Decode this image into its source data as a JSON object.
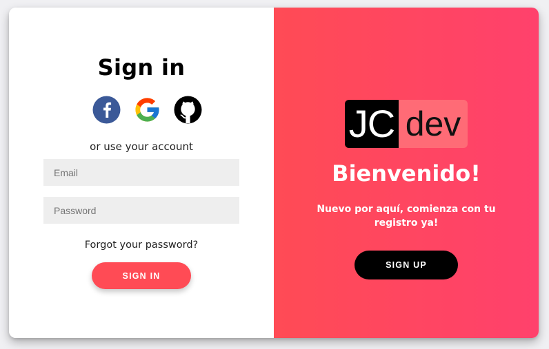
{
  "signin_panel": {
    "title": "Sign in",
    "social": [
      {
        "name": "facebook",
        "icon": "facebook-icon",
        "color": "#3b5998"
      },
      {
        "name": "google",
        "icon": "google-icon"
      },
      {
        "name": "github",
        "icon": "github-icon",
        "color": "#000000"
      }
    ],
    "alt_text": "or use your account",
    "email_placeholder": "Email",
    "password_placeholder": "Password",
    "forgot_label": "Forgot your password?",
    "signin_label": "SIGN IN"
  },
  "welcome_panel": {
    "logo": {
      "part1": "JC",
      "part2": "dev"
    },
    "title": "Bienvenido!",
    "subtitle": "Nuevo por aquí, comienza con tu registro ya!",
    "signup_label": "SIGN UP"
  },
  "colors": {
    "accent": "#ff4b55",
    "gradient_start": "#ff4b55",
    "gradient_end": "#ff416c",
    "input_bg": "#eeeeee"
  }
}
